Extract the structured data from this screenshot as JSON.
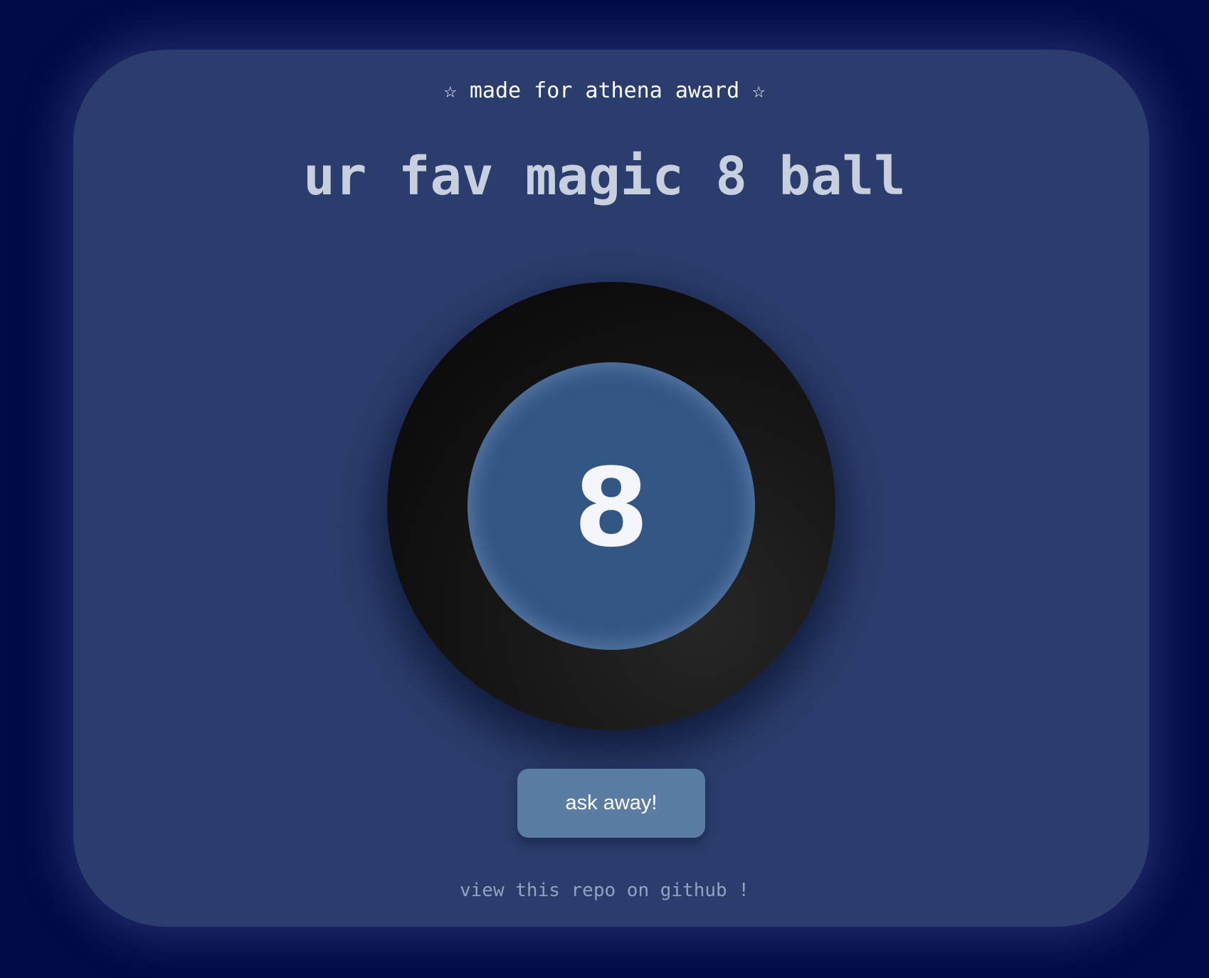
{
  "header": {
    "badge": "☆ made for athena award ☆",
    "title": "ur fav magic 8 ball"
  },
  "ball": {
    "answer": "8"
  },
  "actions": {
    "ask_label": "ask away!"
  },
  "footer": {
    "repo_link": "view this repo on github !"
  },
  "colors": {
    "page_background": "#020b45",
    "card_background": "#2b3d6c",
    "ball_window": "#345684",
    "button": "#5b7ca3"
  }
}
